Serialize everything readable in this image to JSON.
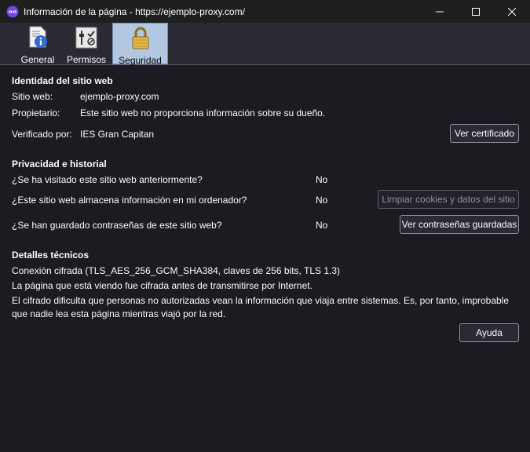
{
  "window": {
    "title": "Información de la página - https://ejemplo-proxy.com/"
  },
  "tabs": [
    {
      "label": "General",
      "icon": "info-document-icon"
    },
    {
      "label": "Permisos",
      "icon": "permissions-icon"
    },
    {
      "label": "Seguridad",
      "icon": "padlock-icon",
      "active": true
    }
  ],
  "identity": {
    "heading": "Identidad del sitio web",
    "site_label": "Sitio web:",
    "site_value": "ejemplo-proxy.com",
    "owner_label": "Propietario:",
    "owner_value": "Este sitio web no proporciona información sobre su dueño.",
    "verified_label": "Verificado por:",
    "verified_value": "IES Gran Capitan",
    "view_cert_button": "Ver certificado"
  },
  "privacy": {
    "heading": "Privacidad e historial",
    "q_visited": "¿Se ha visitado este sitio web anteriormente?",
    "a_visited": "No",
    "q_storage": "¿Este sitio web almacena información en mi ordenador?",
    "a_storage": "No",
    "clear_button": "Limpiar cookies y datos del sitio",
    "q_passwords": "¿Se han guardado contraseñas de este sitio web?",
    "a_passwords": "No",
    "passwords_button": "Ver contraseñas guardadas"
  },
  "technical": {
    "heading": "Detalles técnicos",
    "line1": "Conexión cifrada (TLS_AES_256_GCM_SHA384, claves de 256 bits, TLS 1.3)",
    "line2": "La página que está viendo fue cifrada antes de transmitirse por Internet.",
    "line3": "El cifrado dificulta que personas no autorizadas vean la información que viaja entre sistemas. Es, por tanto, improbable que nadie lea esta página mientras viajó por la red."
  },
  "help_button": "Ayuda",
  "colors": {
    "background": "#1c1b22",
    "toolbar": "#2b2a33",
    "active_tab": "#b3c7e0",
    "text": "#fbfbfe"
  }
}
